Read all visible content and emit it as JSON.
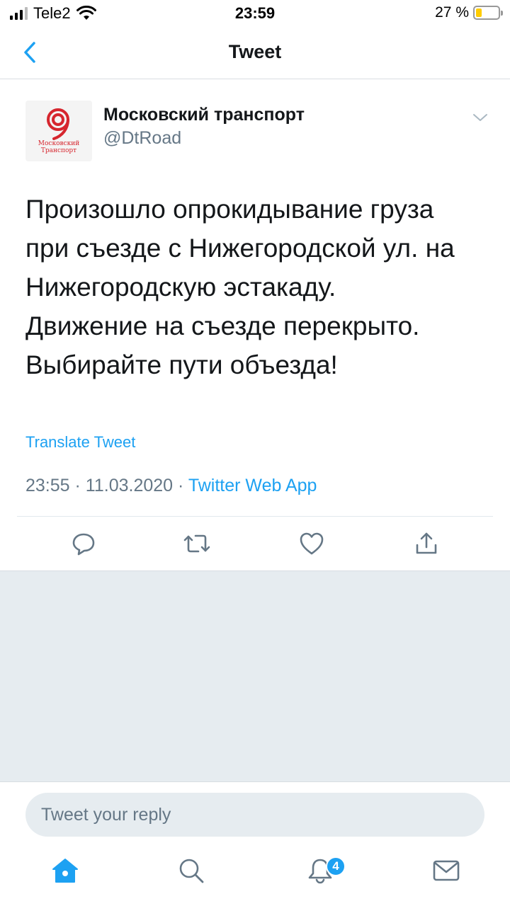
{
  "status_bar": {
    "carrier": "Tele2",
    "time": "23:59",
    "battery_percent": "27 %",
    "battery_level": 0.27
  },
  "nav": {
    "title": "Tweet"
  },
  "tweet": {
    "author_name": "Московский транспорт",
    "author_handle": "@DtRoad",
    "avatar_logo_lines": [
      "Московский",
      "Транспорт"
    ],
    "text_lines": [
      "Произошло опрокидывание груза",
      "при съезде с Нижегородской ул. на",
      "Нижегородскую эстакаду.",
      "Движение на съезде перекрыто.",
      "Выбирайте пути объезда!"
    ],
    "translate_label": "Translate Tweet",
    "time": "23:55",
    "separator": "·",
    "date": "11.03.2020",
    "source": "Twitter Web App"
  },
  "reply": {
    "placeholder": "Tweet your reply"
  },
  "tab_bar": {
    "notifications_badge": "4"
  },
  "colors": {
    "accent": "#1da1f2",
    "secondary_text": "#657786",
    "grey_background": "#e6ecf0",
    "brand_red": "#d6262e"
  },
  "icons": {
    "back": "chevron-left-icon",
    "more": "chevron-down-icon",
    "reply": "comment-icon",
    "retweet": "retweet-icon",
    "like": "heart-icon",
    "share": "share-icon",
    "home": "home-icon",
    "search": "search-icon",
    "notifications": "bell-icon",
    "messages": "mail-icon"
  }
}
